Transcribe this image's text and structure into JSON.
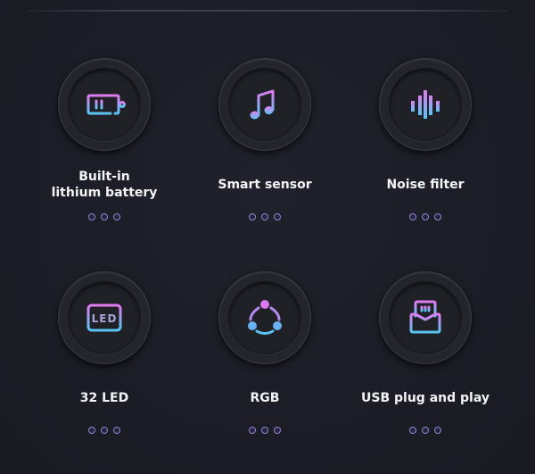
{
  "colors": {
    "background": "#1c1d27",
    "gradient_top": "#e07cf0",
    "gradient_bottom": "#58c6f4",
    "label": "#f4f4f6",
    "dot": "#8f86d8"
  },
  "features": [
    {
      "id": "battery",
      "icon": "battery-icon",
      "label_line1": "Built-in",
      "label_line2": "lithium battery",
      "dots": 3
    },
    {
      "id": "sensor",
      "icon": "music-note-icon",
      "label_line1": "Smart sensor",
      "label_line2": "",
      "dots": 3
    },
    {
      "id": "noise",
      "icon": "sound-wave-icon",
      "label_line1": "Noise filter",
      "label_line2": "",
      "dots": 3
    },
    {
      "id": "led",
      "icon": "led-display-icon",
      "label_line1": "32 LED",
      "label_line2": "",
      "dots": 3
    },
    {
      "id": "rgb",
      "icon": "rgb-cycle-icon",
      "label_line1": "RGB",
      "label_line2": "",
      "dots": 3
    },
    {
      "id": "usb",
      "icon": "usb-plug-icon",
      "label_line1": "USB plug and play",
      "label_line2": "",
      "dots": 3
    }
  ],
  "led_icon_text": "LED"
}
